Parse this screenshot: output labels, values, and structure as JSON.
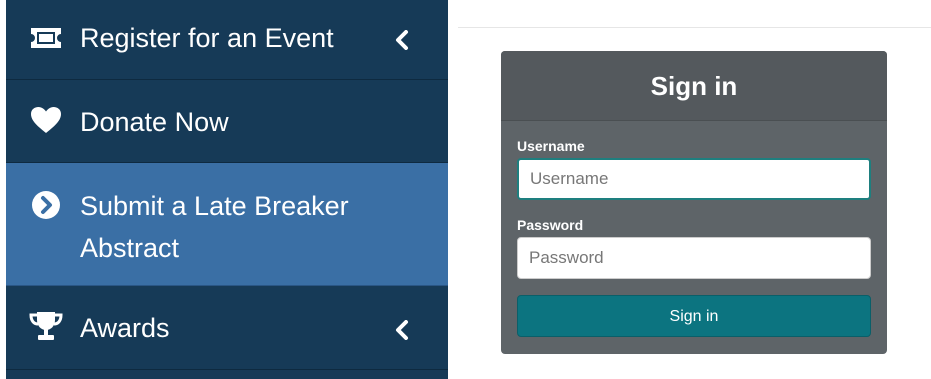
{
  "sidebar": {
    "items": [
      {
        "label": "Register for an Event",
        "icon": "ticket-icon",
        "has_chevron": true
      },
      {
        "label": "Donate Now",
        "icon": "heart-icon",
        "has_chevron": false
      },
      {
        "label": "Submit a Late Breaker Abstract",
        "icon": "chevron-circle-right-icon",
        "has_chevron": false,
        "active": true
      },
      {
        "label": "Awards",
        "icon": "trophy-icon",
        "has_chevron": true
      }
    ]
  },
  "login": {
    "title": "Sign in",
    "username_label": "Username",
    "username_placeholder": "Username",
    "username_value": "",
    "password_label": "Password",
    "password_placeholder": "Password",
    "password_value": "",
    "submit_label": "Sign in"
  },
  "colors": {
    "sidebar_bg": "#163a57",
    "sidebar_active": "#3a6fa5",
    "panel_bg": "#5e6468",
    "panel_header": "#54595d",
    "button": "#0c7480"
  }
}
